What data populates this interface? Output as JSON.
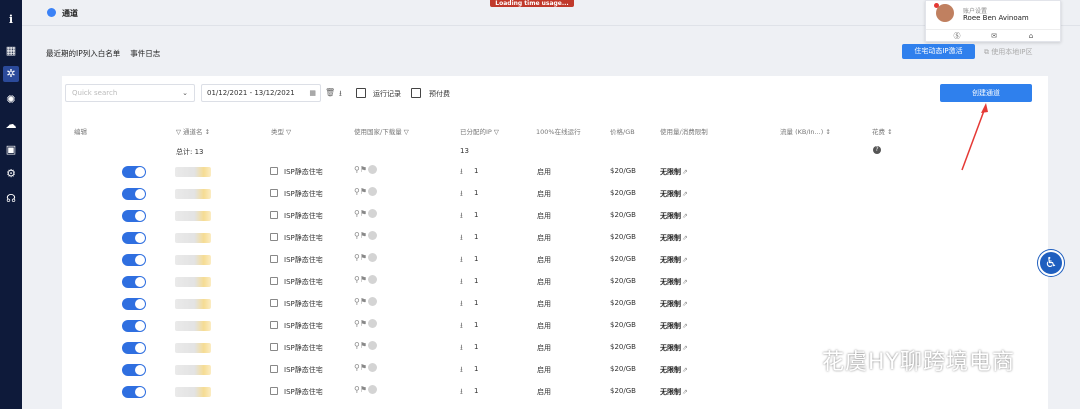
{
  "topbar": {
    "title": "通道",
    "loading": "Loading time usage..."
  },
  "user": {
    "role": "账户设置",
    "name": "Roee Ben Avinoam",
    "icons": [
      "skype-icon",
      "mail-icon",
      "home-icon"
    ]
  },
  "subnav": [
    "最近期的IP列入白名单",
    "事件日志"
  ],
  "actions": {
    "residential_button": "住宅动态IP激活",
    "right_link": "使用本地IP区"
  },
  "toolbar": {
    "search_placeholder": "Quick search",
    "date_range": "01/12/2021 - 13/12/2021",
    "checkbox_running": "运行记录",
    "checkbox_reserved": "预付费",
    "create_button": "创建通道"
  },
  "table": {
    "headers": [
      "编辑",
      "通道名",
      "类型",
      "使用国家/下载量",
      "已分配的IP",
      "100%在线运行",
      "价格/GB",
      "使用量/消费限制",
      "流量 (KB/In...)",
      "花费"
    ],
    "summary": {
      "channel_total": "总计: 13",
      "ip_total": "13"
    },
    "rows": [
      {
        "type": "ISP静态住宅",
        "ips": "1",
        "status": "启用",
        "price": "$20/GB",
        "limit": "无限制"
      },
      {
        "type": "ISP静态住宅",
        "ips": "1",
        "status": "启用",
        "price": "$20/GB",
        "limit": "无限制"
      },
      {
        "type": "ISP静态住宅",
        "ips": "1",
        "status": "启用",
        "price": "$20/GB",
        "limit": "无限制"
      },
      {
        "type": "ISP静态住宅",
        "ips": "1",
        "status": "启用",
        "price": "$20/GB",
        "limit": "无限制"
      },
      {
        "type": "ISP静态住宅",
        "ips": "1",
        "status": "启用",
        "price": "$20/GB",
        "limit": "无限制"
      },
      {
        "type": "ISP静态住宅",
        "ips": "1",
        "status": "启用",
        "price": "$20/GB",
        "limit": "无限制"
      },
      {
        "type": "ISP静态住宅",
        "ips": "1",
        "status": "启用",
        "price": "$20/GB",
        "limit": "无限制"
      },
      {
        "type": "ISP静态住宅",
        "ips": "1",
        "status": "启用",
        "price": "$20/GB",
        "limit": "无限制"
      },
      {
        "type": "ISP静态住宅",
        "ips": "1",
        "status": "启用",
        "price": "$20/GB",
        "limit": "无限制"
      },
      {
        "type": "ISP静态住宅",
        "ips": "1",
        "status": "启用",
        "price": "$20/GB",
        "limit": "无限制"
      },
      {
        "type": "ISP静态住宅",
        "ips": "1",
        "status": "启用",
        "price": "$20/GB",
        "limit": "无限制"
      }
    ]
  },
  "watermark": "花虞HY聊跨境电商",
  "colors": {
    "accent": "#2f80ed",
    "sidebar": "#0e1a3a",
    "annotation_arrow": "#e53935"
  }
}
